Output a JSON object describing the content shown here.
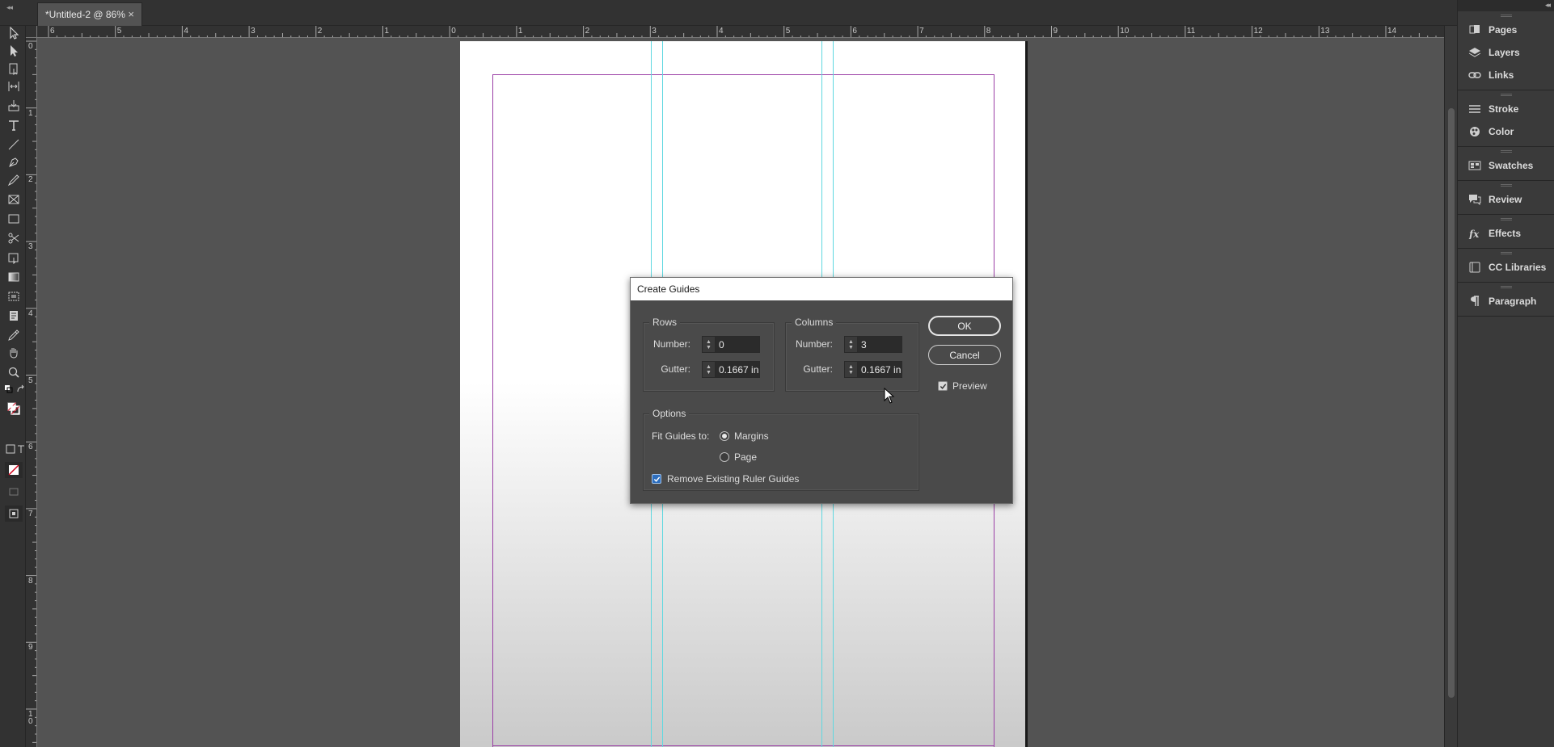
{
  "document_tab": {
    "title": "*Untitled-2 @ 86%",
    "close_glyph": "×"
  },
  "horizontal_ruler": {
    "labels": [
      "6",
      "5",
      "4",
      "3",
      "2",
      "1",
      "0",
      "1",
      "2",
      "3",
      "4",
      "5",
      "6",
      "7",
      "8",
      "9",
      "10",
      "11",
      "12",
      "13",
      "14"
    ]
  },
  "vertical_ruler": {
    "labels": [
      "0",
      "1",
      "2",
      "3",
      "4",
      "5",
      "6",
      "7",
      "8",
      "9",
      "10"
    ]
  },
  "toolbar": {
    "tools": [
      "selection-tool-icon",
      "direct-selection-tool-icon",
      "page-tool-icon",
      "gap-tool-icon",
      "content-collector-icon",
      "type-tool-icon",
      "line-tool-icon",
      "pen-tool-icon",
      "pencil-tool-icon",
      "rectangle-frame-tool-icon",
      "rectangle-tool-icon",
      "scissors-tool-icon",
      "free-transform-tool-icon",
      "gradient-swatch-tool-icon",
      "gradient-feather-tool-icon",
      "note-tool-icon",
      "eyedropper-tool-icon",
      "hand-tool-icon",
      "zoom-tool-icon"
    ]
  },
  "panels": {
    "groups": [
      [
        {
          "label": "Pages",
          "icon": "pages-icon"
        },
        {
          "label": "Layers",
          "icon": "layers-icon"
        },
        {
          "label": "Links",
          "icon": "links-icon"
        }
      ],
      [
        {
          "label": "Stroke",
          "icon": "stroke-icon"
        },
        {
          "label": "Color",
          "icon": "color-icon"
        }
      ],
      [
        {
          "label": "Swatches",
          "icon": "swatches-icon"
        }
      ],
      [
        {
          "label": "Review",
          "icon": "review-icon"
        }
      ],
      [
        {
          "label": "Effects",
          "icon": "effects-icon"
        }
      ],
      [
        {
          "label": "CC Libraries",
          "icon": "cc-libraries-icon"
        }
      ],
      [
        {
          "label": "Paragraph",
          "icon": "paragraph-icon"
        }
      ]
    ]
  },
  "dialog": {
    "title": "Create Guides",
    "rows": {
      "legend": "Rows",
      "number_label": "Number:",
      "number_value": "0",
      "gutter_label": "Gutter:",
      "gutter_value": "0.1667 in"
    },
    "columns": {
      "legend": "Columns",
      "number_label": "Number:",
      "number_value": "3",
      "gutter_label": "Gutter:",
      "gutter_value": "0.1667 in"
    },
    "options": {
      "legend": "Options",
      "fit_label": "Fit Guides to:",
      "margins_label": "Margins",
      "page_label": "Page",
      "fit_selected": "Margins",
      "remove_label": "Remove Existing Ruler Guides",
      "remove_checked": true
    },
    "ok_label": "OK",
    "cancel_label": "Cancel",
    "preview_label": "Preview",
    "preview_checked": true
  },
  "colors": {
    "margin": "#9b3fa6",
    "guide": "#5fd8e0",
    "accent": "#2e6fbf"
  }
}
